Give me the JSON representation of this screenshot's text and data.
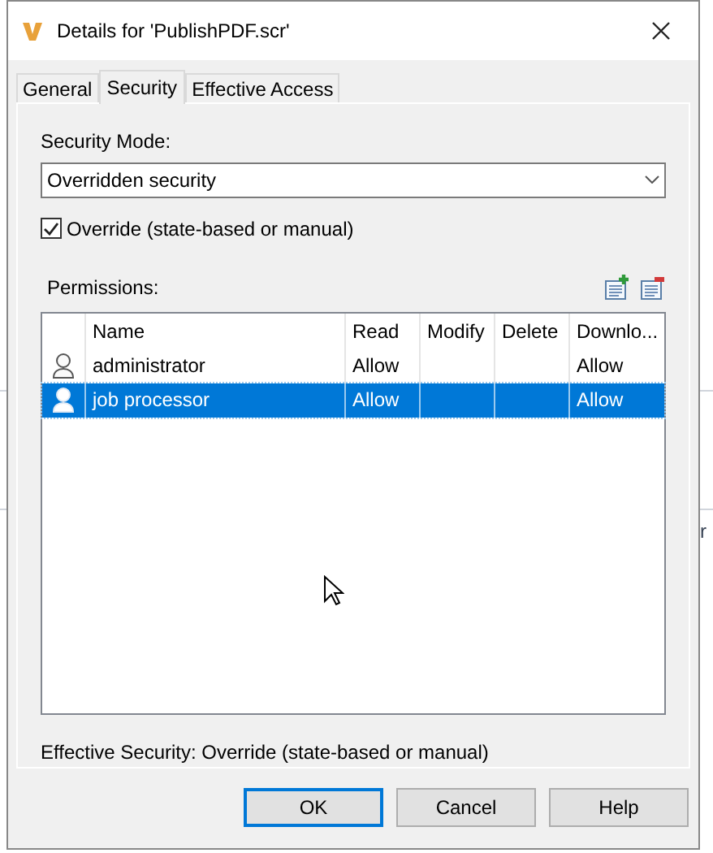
{
  "window": {
    "title": "Details for 'PublishPDF.scr'"
  },
  "background_text": "r",
  "tabs": [
    {
      "label": "General",
      "selected": false
    },
    {
      "label": "Security",
      "selected": true
    },
    {
      "label": "Effective Access",
      "selected": false
    }
  ],
  "security_mode": {
    "label": "Security Mode:",
    "value": "Overridden security"
  },
  "override": {
    "label": "Override (state-based or manual)",
    "checked": true
  },
  "permissions": {
    "label": "Permissions:",
    "columns": [
      "Name",
      "Read",
      "Modify",
      "Delete",
      "Downlo..."
    ],
    "rows": [
      {
        "cells": [
          "administrator",
          "Allow",
          "",
          "",
          "Allow"
        ],
        "selected": false
      },
      {
        "cells": [
          "job processor",
          "Allow",
          "",
          "",
          "Allow"
        ],
        "selected": true
      }
    ]
  },
  "effective_security": "Effective Security: Override (state-based or manual)",
  "buttons": [
    {
      "label": "OK",
      "default": true
    },
    {
      "label": "Cancel",
      "default": false
    },
    {
      "label": "Help",
      "default": false
    }
  ]
}
